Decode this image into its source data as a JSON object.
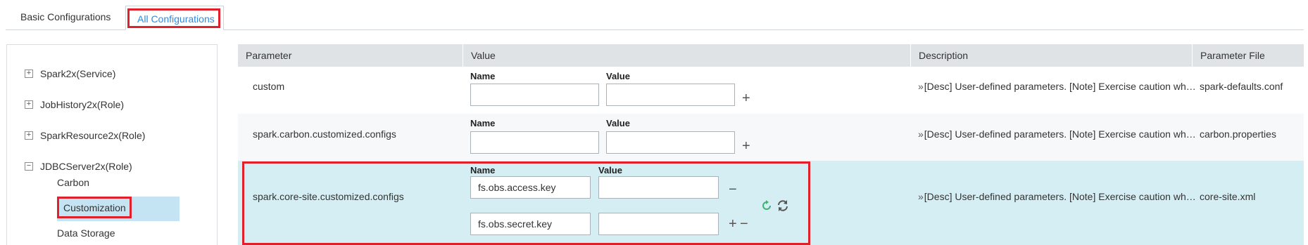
{
  "tabs": {
    "basic": "Basic Configurations",
    "all": "All Configurations"
  },
  "tree": {
    "nodes": [
      {
        "toggle": "+",
        "label": "Spark2x(Service)"
      },
      {
        "toggle": "+",
        "label": "JobHistory2x(Role)"
      },
      {
        "toggle": "+",
        "label": "SparkResource2x(Role)"
      },
      {
        "toggle": "−",
        "label": "JDBCServer2x(Role)"
      }
    ],
    "children": [
      "Carbon",
      "Customization",
      "Data Storage"
    ]
  },
  "table": {
    "headers": [
      "Parameter",
      "Value",
      "Description",
      "Parameter File"
    ],
    "name_label": "Name",
    "value_label": "Value",
    "rows": [
      {
        "parameter": "custom",
        "description": "[Desc] User-defined parameters. [Note] Exercise caution when adding or modifying parameters.",
        "file": "spark-defaults.conf"
      },
      {
        "parameter": "spark.carbon.customized.configs",
        "description": "[Desc] User-defined parameters. [Note] Exercise caution when adding or modifying parameters.",
        "file": "carbon.properties"
      },
      {
        "parameter": "spark.core-site.customized.configs",
        "description": "[Desc] User-defined parameters. [Note] Exercise caution when adding or modifying parameters.",
        "file": "core-site.xml",
        "entries": [
          {
            "name": "fs.obs.access.key",
            "value": ""
          },
          {
            "name": "fs.obs.secret.key",
            "value": ""
          }
        ]
      }
    ],
    "plus_symbol": "+",
    "minus_symbol": "−",
    "chevron": "»"
  },
  "colors": {
    "accent": "#2f8ae5",
    "highlight_border": "#e0202a",
    "selected_row": "#d4eef4",
    "selected_tree_item": "#c5e4f3",
    "header_bg": "#dfe3e6",
    "refresh_icon": "#3cb371"
  }
}
